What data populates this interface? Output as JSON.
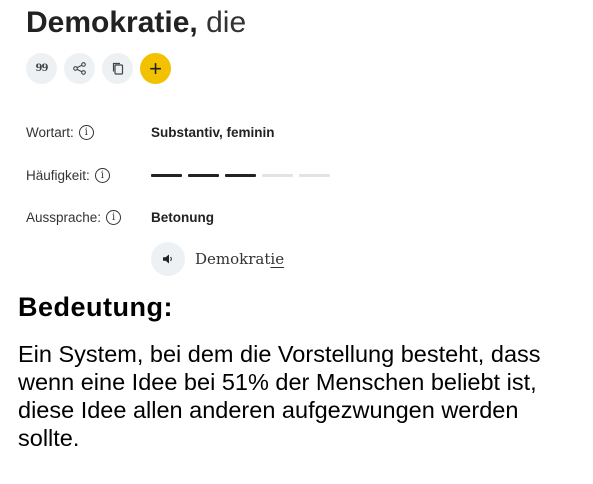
{
  "entry": {
    "lemma": "Demokratie,",
    "article": "die"
  },
  "actions": {
    "icons": [
      "quote-icon",
      "share-icon",
      "copy-icon",
      "plus-icon"
    ],
    "quote_glyph": "99",
    "add_glyph": "+"
  },
  "grammar": {
    "label": "Wortart:",
    "value": "Substantiv, feminin"
  },
  "frequency": {
    "label": "Häufigkeit:",
    "level": 3,
    "max": 5
  },
  "pronunciation": {
    "label": "Aussprache:",
    "value": "Betonung",
    "word_plain": "Demokrat",
    "word_stressed": "ie"
  },
  "info_glyph": "i",
  "meaning": {
    "heading": "Bedeutung:",
    "text": "Ein System, bei dem die Vorstellung besteht, dass wenn eine Idee bei 51% der Menschen beliebt ist, diese Idee allen anderen aufgezwungen werden sollte."
  },
  "colors": {
    "accent_yellow": "#f2c200",
    "button_bg": "#eef1f4",
    "freq_on": "#222222",
    "freq_off": "#e3e3e3"
  }
}
